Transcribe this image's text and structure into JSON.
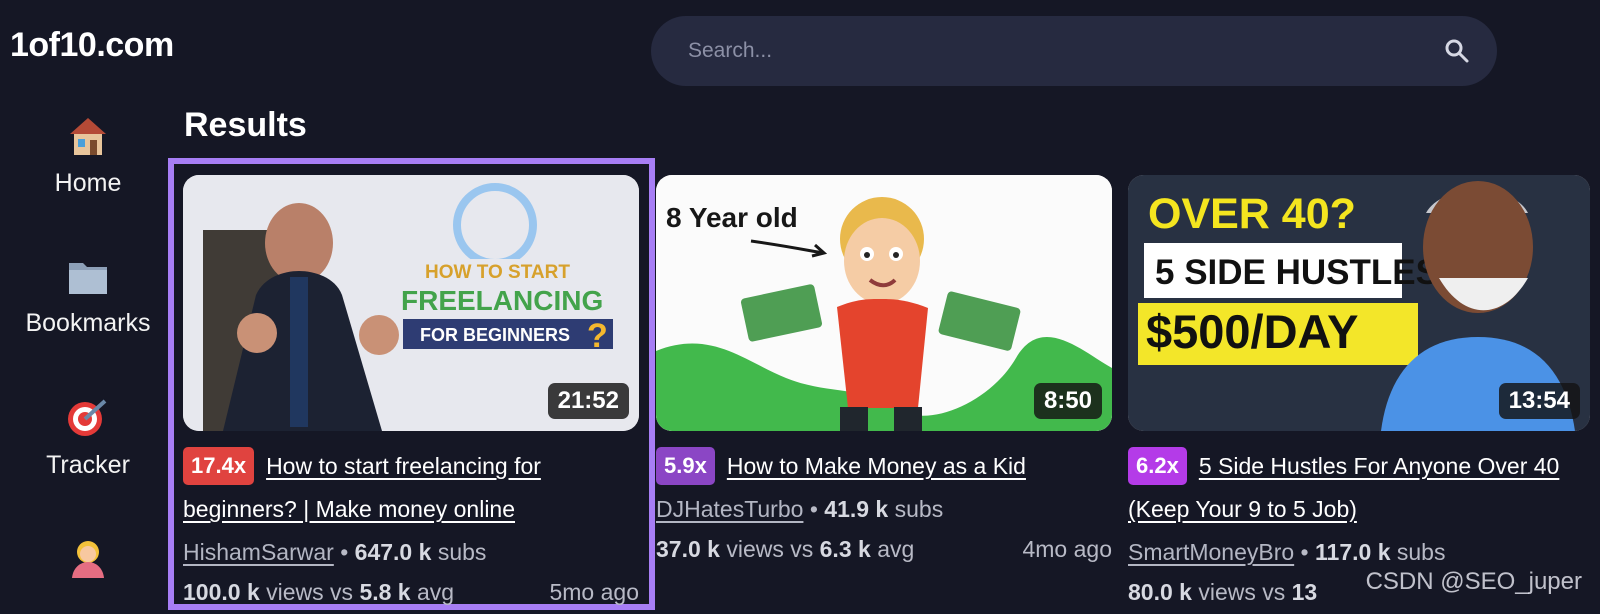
{
  "site": {
    "logo": "1of10.com"
  },
  "search": {
    "placeholder": "Search..."
  },
  "sidebar": {
    "items": [
      {
        "label": "Home",
        "icon": "house-icon"
      },
      {
        "label": "Bookmarks",
        "icon": "folder-icon"
      },
      {
        "label": "Tracker",
        "icon": "target-icon"
      },
      {
        "label": "",
        "icon": "person-icon"
      }
    ]
  },
  "results": {
    "heading": "Results",
    "videos": [
      {
        "multiplier": "17.4x",
        "badge_color": "#e0433f",
        "title": "How to start freelancing for beginners? | Make money online",
        "channel": "HishamSarwar",
        "subs": "647.0 k",
        "subs_suffix": "subs",
        "views": "100.0 k",
        "avg": "5.8 k",
        "ago": "5mo ago",
        "duration": "21:52",
        "thumb_text": [
          "HOW TO START",
          "FREELANCING",
          "FOR BEGINNERS"
        ],
        "selected": true
      },
      {
        "multiplier": "5.9x",
        "badge_color": "#8b46c5",
        "title": "How to Make Money as a Kid",
        "channel": "DJHatesTurbo",
        "subs": "41.9 k",
        "subs_suffix": "subs",
        "views": "37.0 k",
        "avg": "6.3 k",
        "ago": "4mo ago",
        "duration": "8:50",
        "thumb_text": [
          "8 Year old"
        ],
        "selected": false
      },
      {
        "multiplier": "6.2x",
        "badge_color": "#b43be8",
        "title": "5 Side Hustles For Anyone Over 40 (Keep Your 9 to 5 Job)",
        "channel": "SmartMoneyBro",
        "subs": "117.0 k",
        "subs_suffix": "subs",
        "views": "80.0 k",
        "avg": "13",
        "ago": "",
        "duration": "13:54",
        "thumb_text": [
          "OVER 40?",
          "5 SIDE HUSTLES",
          "$500/DAY"
        ],
        "selected": false
      }
    ],
    "labels": {
      "views": "views vs",
      "avg": "avg"
    }
  },
  "watermark": "CSDN @SEO_juper"
}
